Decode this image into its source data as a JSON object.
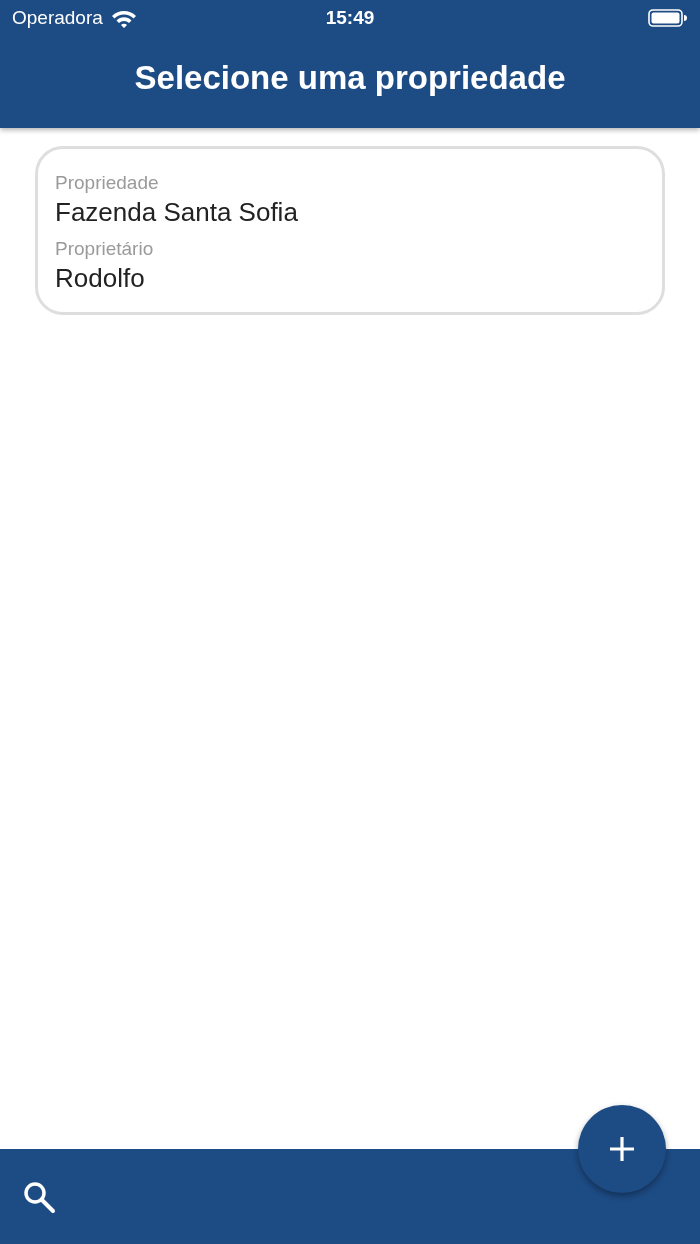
{
  "status_bar": {
    "carrier": "Operadora",
    "time": "15:49"
  },
  "header": {
    "title": "Selecione uma propriedade"
  },
  "properties": [
    {
      "property_label": "Propriedade",
      "property": "Fazenda Santa Sofia",
      "owner_label": "Proprietário",
      "owner": "Rodolfo"
    }
  ]
}
